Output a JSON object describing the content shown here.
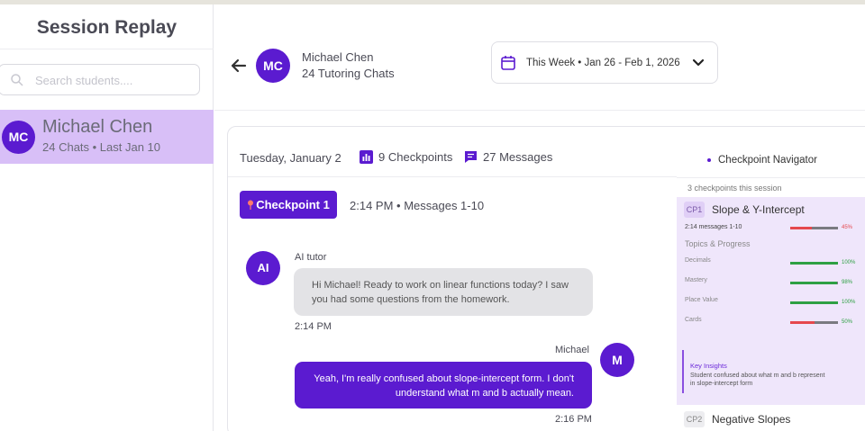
{
  "sidebar": {
    "title": "Session Replay",
    "search_placeholder": "Search students....",
    "students": [
      {
        "initials": "MC",
        "name": "Michael Chen",
        "meta": "24 Chats • Last Jan 10"
      }
    ]
  },
  "header": {
    "initials": "MC",
    "name": "Michael Chen",
    "subtitle": "24 Tutoring Chats",
    "date_range": "This Week  • Jan 26 - Feb 1, 2026"
  },
  "session": {
    "day": "Tuesday, January 2",
    "checkpoints": "9 Checkpoints",
    "messages": "27 Messages",
    "checkpoint_label": "Checkpoint 1",
    "checkpoint_info": "2:14 PM • Messages 1-10",
    "chat": [
      {
        "sender": "AI tutor",
        "initials": "AI",
        "text": "Hi Michael! Ready to work on linear functions today? I saw you had some questions from the homework.",
        "time": "2:14 PM"
      },
      {
        "sender": "Michael",
        "initials": "M",
        "text": "Yeah, I'm really confused about  slope-intercept form. I don't understand what m and b actually mean.",
        "time": "2:16 PM"
      }
    ]
  },
  "navigator": {
    "title": "Checkpoint Navigator",
    "count": "3 checkpoints this session",
    "checkpoints": [
      {
        "code": "CP1",
        "title": "Slope & Y-Intercept",
        "messages": "2:14 messages 1-10",
        "progress": {
          "value": 45,
          "label": "45%"
        },
        "topics_heading": "Topics & Progress",
        "topics": [
          {
            "name": "Decimals",
            "value": 100,
            "label": "100%"
          },
          {
            "name": "Mastery",
            "value": 98,
            "label": "98%"
          },
          {
            "name": "Place Value",
            "value": 100,
            "label": "100%"
          },
          {
            "name": "Cards",
            "value": 50,
            "label": "50%"
          }
        ],
        "insight_heading": "Key Insights",
        "insight_text": "Student confused about what m and b represent in slope-intercept form"
      },
      {
        "code": "CP2",
        "title": "Negative Slopes"
      }
    ]
  },
  "colors": {
    "brand": "#5b1bd0",
    "highlight": "#d8bff7",
    "good": "#2ea043",
    "bad": "#e5484d"
  }
}
